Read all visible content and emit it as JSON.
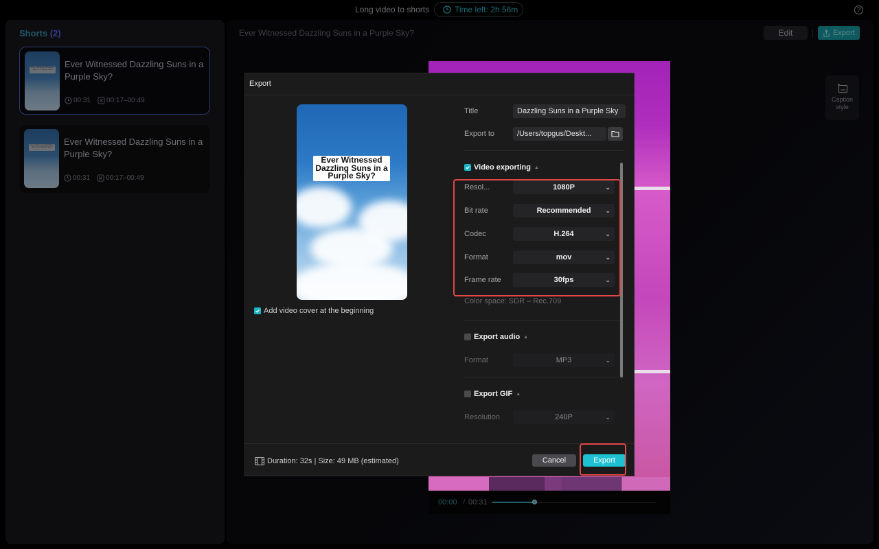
{
  "topbar": {
    "app_title": "Long video to shorts",
    "time_left": "Time left: 2h 56m",
    "help_icon": "?"
  },
  "sidebar": {
    "heading": "Shorts",
    "count": "(2)",
    "shorts": [
      {
        "title": "Ever Witnessed Dazzling Suns in a Purple Sky?",
        "duration": "00:31",
        "range": "00:17–00:49",
        "thumb_caption": "Ever Witnessed Dazzling Suns in a Purple Sky?",
        "selected": true
      },
      {
        "title": "Ever Witnessed Dazzling Suns in a Purple Sky?",
        "duration": "00:31",
        "range": "00:17–00:49",
        "thumb_caption": "Ever Witnessed Dazzling Suns in a Purple Sky?",
        "selected": false
      }
    ]
  },
  "main": {
    "video_title": "Ever Witnessed Dazzling Suns in a Purple Sky?",
    "edit_label": "Edit",
    "export_label": "Export",
    "caption_style_label": "Caption style",
    "timeline": {
      "current": "00:00",
      "separator": "/",
      "total": "00:31",
      "progress": 0.26
    }
  },
  "dialog": {
    "title": "Export",
    "cover_caption": "Ever Witnessed Dazzling Suns in a Purple Sky?",
    "add_cover_label": "Add video cover at the beginning",
    "add_cover_checked": true,
    "title_label": "Title",
    "title_value": "Dazzling Suns in a Purple Sky",
    "export_to_label": "Export to",
    "export_to_value": "/Users/topgus/Deskt...",
    "video_section": {
      "label": "Video exporting",
      "checked": true,
      "settings": [
        {
          "label": "Resol...",
          "value": "1080P"
        },
        {
          "label": "Bit rate",
          "value": "Recommended"
        },
        {
          "label": "Codec",
          "value": "H.264"
        },
        {
          "label": "Format",
          "value": "mov"
        },
        {
          "label": "Frame rate",
          "value": "30fps"
        }
      ],
      "color_space": "Color space: SDR – Rec.709"
    },
    "audio_section": {
      "label": "Export audio",
      "checked": false,
      "format_label": "Format",
      "format_value": "MP3"
    },
    "gif_section": {
      "label": "Export GIF",
      "checked": false,
      "resolution_label": "Resolution",
      "resolution_value": "240P"
    },
    "footer": {
      "info": "Duration: 32s | Size: 49 MB (estimated)",
      "cancel_label": "Cancel",
      "export_label": "Export"
    }
  },
  "colors": {
    "accent": "#1ec1d1",
    "highlight": "#e04747",
    "dialog_bg": "#1b1b1b"
  }
}
